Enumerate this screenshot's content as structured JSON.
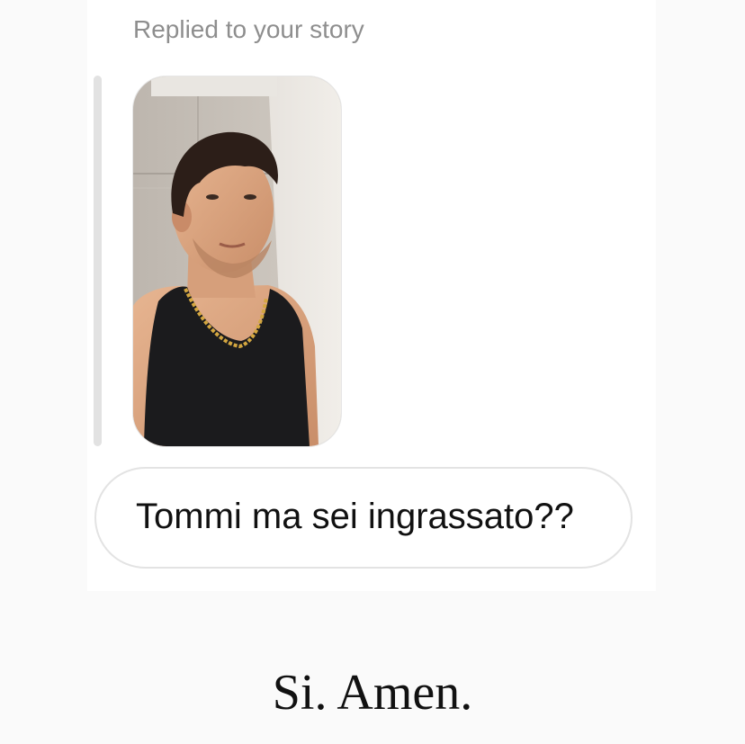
{
  "reply": {
    "caption": "Replied to your story"
  },
  "story": {
    "thumbnail": "story-photo"
  },
  "message": {
    "text": "Tommi ma sei ingrassato??"
  },
  "overlay": {
    "caption": "Si. Amen."
  },
  "colors": {
    "background": "#fafafa",
    "card": "#ffffff",
    "caption_gray": "#8e8e8e",
    "bubble_border": "#e3e3e3",
    "text": "#111111"
  }
}
